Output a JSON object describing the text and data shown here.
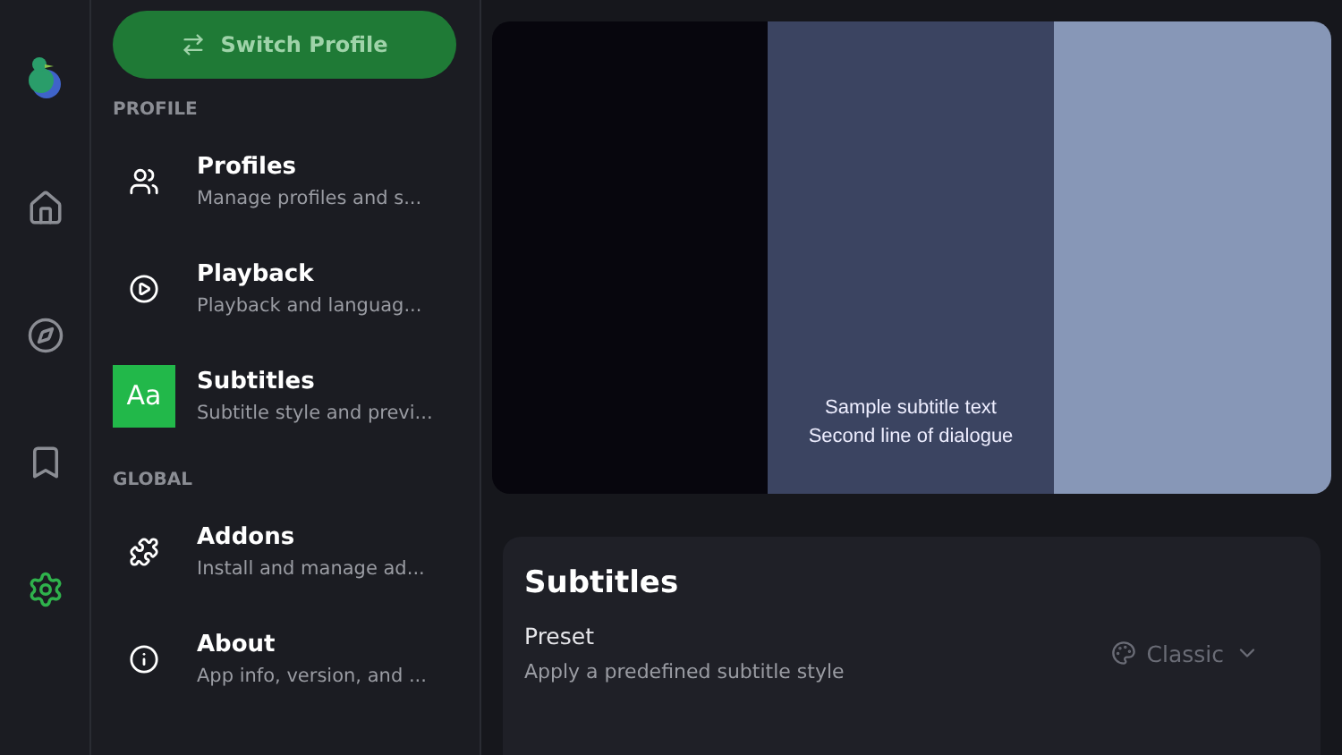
{
  "rail": {
    "items": [
      {
        "selected": false
      },
      {
        "selected": false
      },
      {
        "selected": false
      },
      {
        "selected": true
      }
    ]
  },
  "sidebar": {
    "switch_button": "Switch Profile",
    "sections": [
      {
        "title": "PROFILE",
        "items": [
          {
            "title": "Profiles",
            "subtitle": "Manage profiles and s...",
            "selected": false
          },
          {
            "title": "Playback",
            "subtitle": "Playback and languag...",
            "selected": false
          },
          {
            "title": "Subtitles",
            "subtitle": "Subtitle style and previ...",
            "selected": true,
            "badge": "Aa"
          }
        ]
      },
      {
        "title": "GLOBAL",
        "items": [
          {
            "title": "Addons",
            "subtitle": "Install and manage ad...",
            "selected": false
          },
          {
            "title": "About",
            "subtitle": "App info, version, and ...",
            "selected": false
          }
        ]
      }
    ]
  },
  "preview": {
    "lines": [
      "Sample subtitle text",
      "Second line of dialogue"
    ]
  },
  "card": {
    "title": "Subtitles",
    "setting": {
      "label": "Preset",
      "description": "Apply a predefined subtitle style",
      "value": "Classic",
      "disabled": true
    }
  }
}
